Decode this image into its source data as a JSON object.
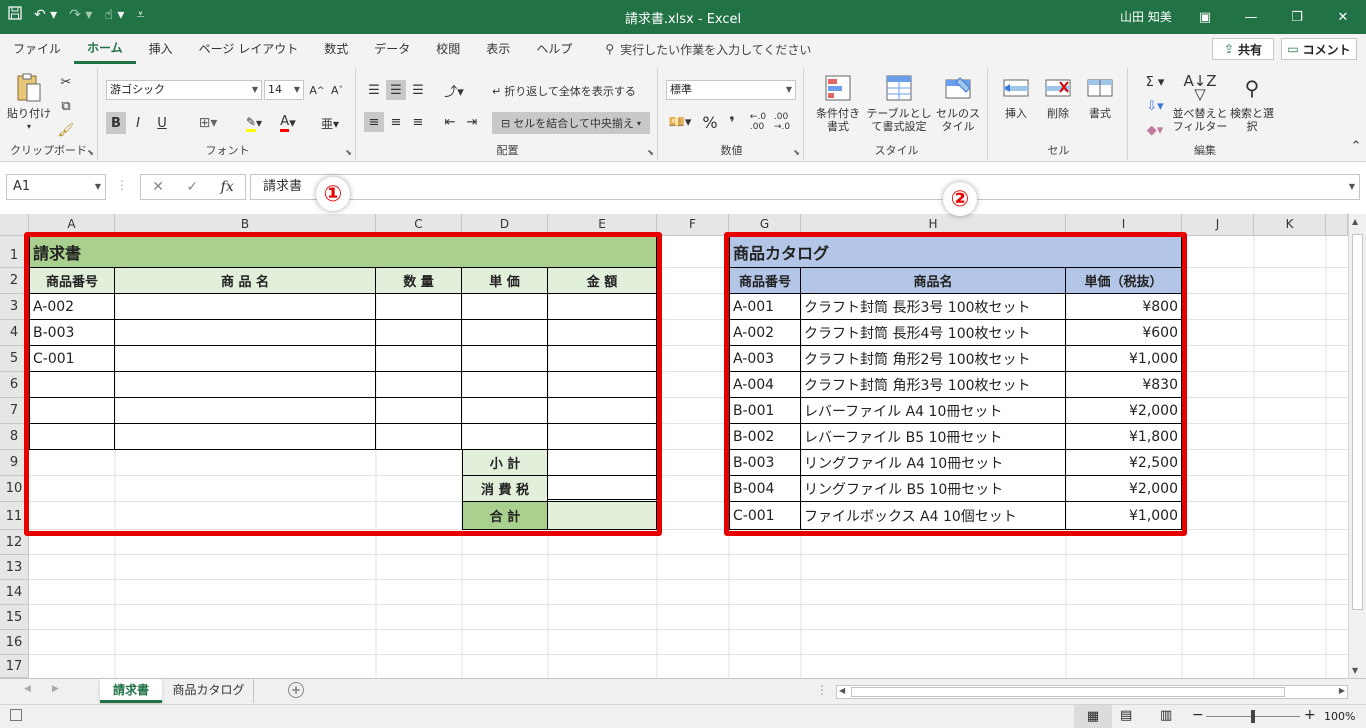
{
  "titlebar": {
    "title": "請求書.xlsx  -  Excel",
    "user": "山田 知美",
    "qat_icons": [
      "save-icon",
      "undo-icon",
      "redo-icon",
      "touch-mode-icon",
      "customize-icon"
    ]
  },
  "tabs": {
    "items": [
      "ファイル",
      "ホーム",
      "挿入",
      "ページ レイアウト",
      "数式",
      "データ",
      "校閲",
      "表示",
      "ヘルプ"
    ],
    "tell_me": "実行したい作業を入力してください",
    "share": "共有",
    "comment": "コメント"
  },
  "ribbon": {
    "clipboard": {
      "label": "クリップボード",
      "paste": "貼り付け"
    },
    "font": {
      "label": "フォント",
      "font_name": "游ゴシック",
      "font_size": "14",
      "bold": "B",
      "italic": "I",
      "underline": "U"
    },
    "alignment": {
      "label": "配置",
      "wrap_text": "折り返して全体を表示する",
      "merge_center": "セルを結合して中央揃え"
    },
    "number": {
      "label": "数値",
      "format": "標準"
    },
    "styles": {
      "label": "スタイル",
      "conditional": "条件付き書式",
      "table": "テーブルとして書式設定",
      "cell_styles": "セルのスタイル"
    },
    "cells": {
      "label": "セル",
      "insert": "挿入",
      "delete": "削除",
      "format": "書式"
    },
    "editing": {
      "label": "編集",
      "sort_filter": "並べ替えとフィルター",
      "find_select": "検索と選択"
    }
  },
  "formula_bar": {
    "name_box": "A1",
    "content": "請求書",
    "fx": "fx"
  },
  "columns": [
    "A",
    "B",
    "C",
    "D",
    "E",
    "F",
    "G",
    "H",
    "I",
    "J",
    "K"
  ],
  "rows": [
    "1",
    "2",
    "3",
    "4",
    "5",
    "6",
    "7",
    "8",
    "9",
    "10",
    "11",
    "12",
    "13",
    "14",
    "15",
    "16",
    "17"
  ],
  "invoice": {
    "title": "請求書",
    "headers": [
      "商品番号",
      "商 品 名",
      "数 量",
      "単 価",
      "金 額"
    ],
    "codes": [
      "A-002",
      "B-003",
      "C-001",
      "",
      "",
      ""
    ],
    "subtotal": "小 計",
    "tax": "消 費 税",
    "total": "合 計"
  },
  "catalog": {
    "title": "商品カタログ",
    "headers": [
      "商品番号",
      "商品名",
      "単価（税抜）"
    ],
    "items": [
      {
        "code": "A-001",
        "name": "クラフト封筒 長形3号 100枚セット",
        "price": "¥800"
      },
      {
        "code": "A-002",
        "name": "クラフト封筒 長形4号 100枚セット",
        "price": "¥600"
      },
      {
        "code": "A-003",
        "name": "クラフト封筒 角形2号 100枚セット",
        "price": "¥1,000"
      },
      {
        "code": "A-004",
        "name": "クラフト封筒 角形3号 100枚セット",
        "price": "¥830"
      },
      {
        "code": "B-001",
        "name": "レバーファイル A4 10冊セット",
        "price": "¥2,000"
      },
      {
        "code": "B-002",
        "name": "レバーファイル B5 10冊セット",
        "price": "¥1,800"
      },
      {
        "code": "B-003",
        "name": "リングファイル A4 10冊セット",
        "price": "¥2,500"
      },
      {
        "code": "B-004",
        "name": "リングファイル B5 10冊セット",
        "price": "¥2,000"
      },
      {
        "code": "C-001",
        "name": "ファイルボックス A4 10個セット",
        "price": "¥1,000"
      }
    ]
  },
  "annotations": {
    "marker1": "①",
    "marker2": "②",
    "color": "#e60000"
  },
  "sheet_tabs": [
    "請求書",
    "商品カタログ"
  ],
  "status": {
    "zoom": "100%"
  },
  "colors": {
    "accent": "#217346",
    "invoice_header": "#a9d08e",
    "invoice_light": "#e2efda",
    "catalog_header": "#b4c6e7"
  }
}
